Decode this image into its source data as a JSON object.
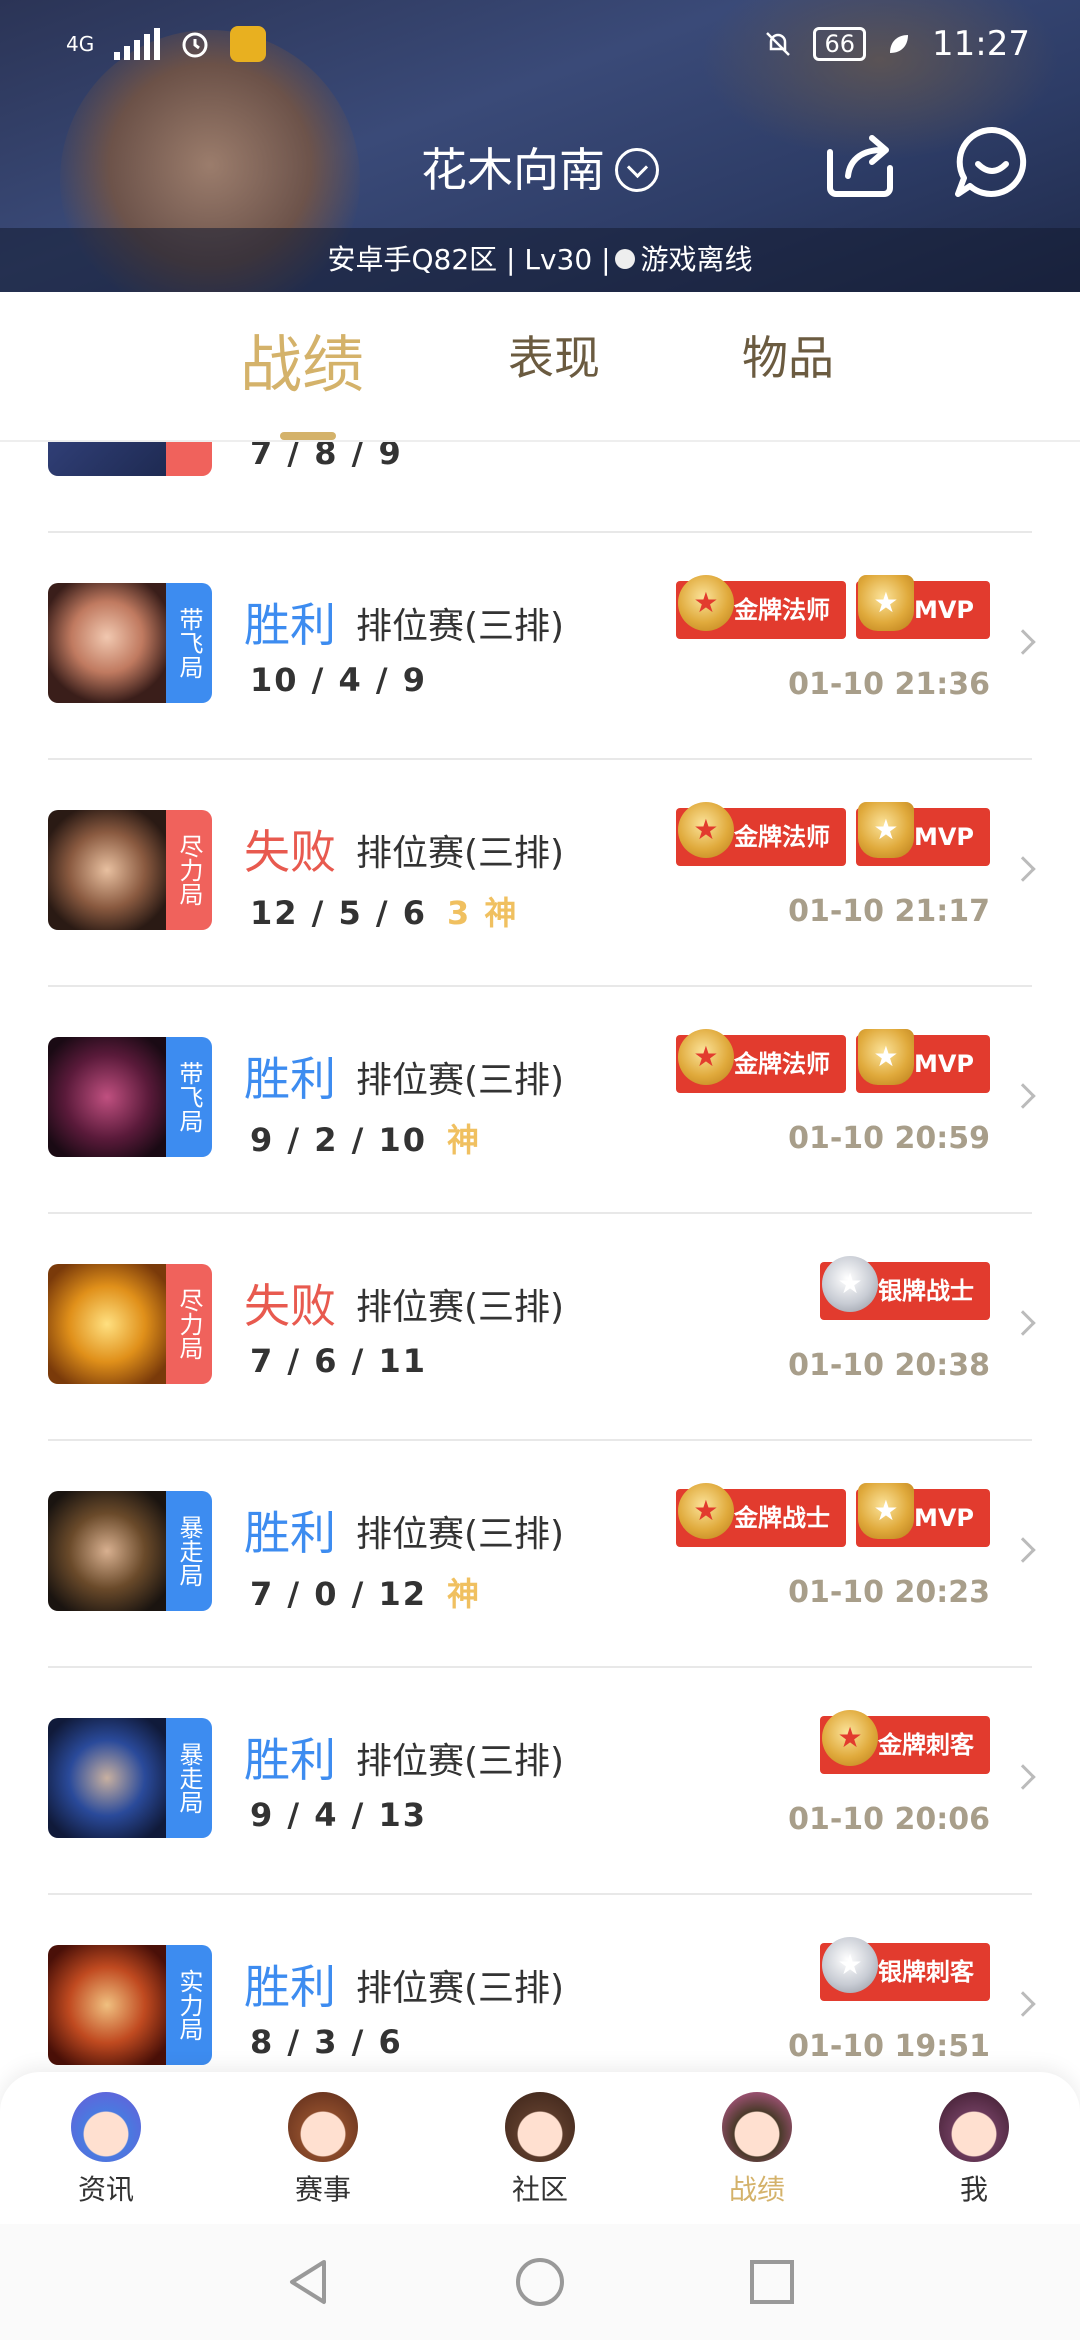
{
  "status_bar": {
    "network": "4G",
    "battery": "66",
    "time": "11:27"
  },
  "header": {
    "nickname": "花木向南",
    "server_info": "安卓手Q82区 | Lv30 |",
    "online_status": "游戏离线"
  },
  "tabs": [
    {
      "label": "战绩",
      "active": true
    },
    {
      "label": "表现",
      "active": false
    },
    {
      "label": "物品",
      "active": false
    }
  ],
  "matches": [
    {
      "tag": "",
      "tag_color": "red",
      "result": "",
      "mode": "",
      "kda": "7 / 8 / 9",
      "god": "",
      "badges": [],
      "time": "",
      "partial": true
    },
    {
      "tag": "带飞局",
      "tag_color": "blue",
      "result": "胜利",
      "outcome": "win",
      "mode": "排位赛(三排)",
      "kda": "10 / 4 / 9",
      "god": "",
      "badges": [
        {
          "label": "金牌法师",
          "kind": "gold"
        },
        {
          "label": "MVP",
          "kind": "mvp"
        }
      ],
      "time": "01-10 21:36"
    },
    {
      "tag": "尽力局",
      "tag_color": "red",
      "result": "失败",
      "outcome": "lose",
      "mode": "排位赛(三排)",
      "kda": "12 / 5 / 6",
      "god": "3 神",
      "badges": [
        {
          "label": "金牌法师",
          "kind": "gold"
        },
        {
          "label": "MVP",
          "kind": "mvp"
        }
      ],
      "time": "01-10 21:17"
    },
    {
      "tag": "带飞局",
      "tag_color": "blue",
      "result": "胜利",
      "outcome": "win",
      "mode": "排位赛(三排)",
      "kda": "9 / 2 / 10",
      "god": "神",
      "badges": [
        {
          "label": "金牌法师",
          "kind": "gold"
        },
        {
          "label": "MVP",
          "kind": "mvp"
        }
      ],
      "time": "01-10 20:59"
    },
    {
      "tag": "尽力局",
      "tag_color": "red",
      "result": "失败",
      "outcome": "lose",
      "mode": "排位赛(三排)",
      "kda": "7 / 6 / 11",
      "god": "",
      "badges": [
        {
          "label": "银牌战士",
          "kind": "silver"
        }
      ],
      "time": "01-10 20:38"
    },
    {
      "tag": "暴走局",
      "tag_color": "blue",
      "result": "胜利",
      "outcome": "win",
      "mode": "排位赛(三排)",
      "kda": "7 / 0 / 12",
      "god": "神",
      "badges": [
        {
          "label": "金牌战士",
          "kind": "gold"
        },
        {
          "label": "MVP",
          "kind": "mvp"
        }
      ],
      "time": "01-10 20:23"
    },
    {
      "tag": "暴走局",
      "tag_color": "blue",
      "result": "胜利",
      "outcome": "win",
      "mode": "排位赛(三排)",
      "kda": "9 / 4 / 13",
      "god": "",
      "badges": [
        {
          "label": "金牌刺客",
          "kind": "gold"
        }
      ],
      "time": "01-10 20:06"
    },
    {
      "tag": "实力局",
      "tag_color": "blue",
      "result": "胜利",
      "outcome": "win",
      "mode": "排位赛(三排)",
      "kda": "8 / 3 / 6",
      "god": "",
      "badges": [
        {
          "label": "银牌刺客",
          "kind": "silver"
        }
      ],
      "time": "01-10 19:51"
    }
  ],
  "bottom_nav": [
    {
      "label": "资讯",
      "active": false
    },
    {
      "label": "赛事",
      "active": false
    },
    {
      "label": "社区",
      "active": false
    },
    {
      "label": "战绩",
      "active": true
    },
    {
      "label": "我",
      "active": false
    }
  ],
  "colors": {
    "accent_gold": "#d4b26a",
    "win_blue": "#3d8cf0",
    "lose_red": "#e85a4f",
    "badge_red": "#e23b2e"
  }
}
